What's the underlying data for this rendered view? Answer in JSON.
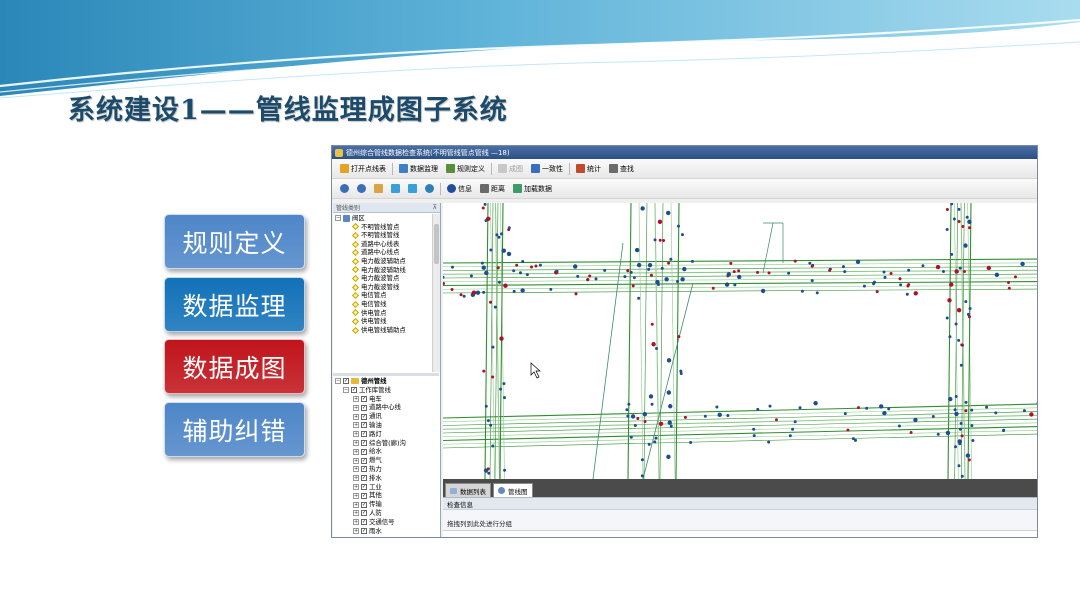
{
  "slide": {
    "title": "系统建设1——管线监理成图子系统"
  },
  "side_buttons": [
    {
      "label": "规则定义",
      "color": "#4e86c8"
    },
    {
      "label": "数据监理",
      "color": "#1271b8"
    },
    {
      "label": "数据成图",
      "color": "#c0141b"
    },
    {
      "label": "辅助纠错",
      "color": "#4e86c8"
    }
  ],
  "app": {
    "window_title": "德州综合管线数据检查系统(不明管线管点管线  —18)",
    "toolbar1": [
      {
        "label": "打开点线表",
        "icon": "open-table-icon",
        "enabled": true
      },
      {
        "label": "数据监理",
        "icon": "data-supervise-icon",
        "enabled": true
      },
      {
        "label": "规则定义",
        "icon": "rule-define-icon",
        "enabled": true
      },
      {
        "label": "成图",
        "icon": "make-map-icon",
        "enabled": false
      },
      {
        "label": "一致性",
        "icon": "consistency-icon",
        "enabled": true
      },
      {
        "label": "统计",
        "icon": "statistics-icon",
        "enabled": true
      },
      {
        "label": "查找",
        "icon": "find-icon",
        "enabled": true
      }
    ],
    "toolbar2": [
      {
        "label": "",
        "icon": "zoom-in-icon"
      },
      {
        "label": "",
        "icon": "zoom-out-icon"
      },
      {
        "label": "",
        "icon": "pan-hand-icon"
      },
      {
        "label": "",
        "icon": "back-icon"
      },
      {
        "label": "",
        "icon": "forward-icon"
      },
      {
        "label": "",
        "icon": "globe-icon"
      },
      {
        "label": "信息",
        "icon": "info-icon"
      },
      {
        "label": "距离",
        "icon": "distance-icon"
      },
      {
        "label": "加载数据",
        "icon": "load-data-icon"
      }
    ],
    "left_panel_title": "管线类别",
    "layer_tree": {
      "root": "阀区",
      "items": [
        "不明管线管点",
        "不明管线管线",
        "道路中心线表",
        "道路中心线点",
        "电力截波辅助点",
        "电力截波辅助线",
        "电力截波管点",
        "电力截波管线",
        "电信管点",
        "电信管线",
        "供电管点",
        "供电管线",
        "供电管线辅助点"
      ]
    },
    "pipe_tree": {
      "root": "德州管线",
      "library": "工作库管线",
      "items": [
        "电车",
        "道路中心线",
        "通讯",
        "输油",
        "路灯",
        "综合管(廊)沟",
        "给水",
        "燃气",
        "热力",
        "排水",
        "工业",
        "其他",
        "传输",
        "人防",
        "交通信号",
        "雨水"
      ]
    },
    "tabs": [
      {
        "label": "数据列表",
        "icon": "table-icon",
        "active": false
      },
      {
        "label": "管线图",
        "icon": "map-icon",
        "active": true
      }
    ],
    "check_panel_title": "检查信息",
    "group_hint": "拖拽列到此处进行分组",
    "map_colors": {
      "pipe": "#2f8f2f",
      "pipe_light": "#8fc98f",
      "node": "#1e4e8c",
      "node_red": "#b0102a",
      "thin": "#3a8a6a"
    }
  }
}
